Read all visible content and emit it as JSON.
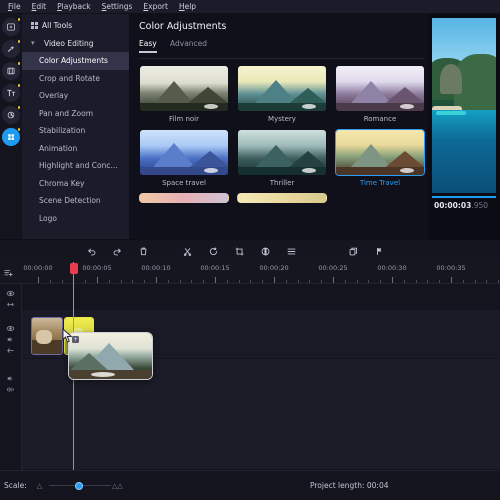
{
  "menu": {
    "items": [
      "File",
      "Edit",
      "Playback",
      "Settings",
      "Export",
      "Help"
    ]
  },
  "rail": {
    "items": [
      {
        "name": "import-media-icon",
        "glyph": "import"
      },
      {
        "name": "magic-wand-icon",
        "glyph": "wand"
      },
      {
        "name": "transitions-icon",
        "glyph": "transition"
      },
      {
        "name": "titles-icon",
        "glyph": "Tt"
      },
      {
        "name": "stickers-icon",
        "glyph": "sticker"
      },
      {
        "name": "more-tools-icon",
        "glyph": "grid"
      }
    ]
  },
  "tools_nav": {
    "all_tools": "All Tools",
    "group": "Video Editing",
    "items": [
      "Color Adjustments",
      "Crop and Rotate",
      "Overlay",
      "Pan and Zoom",
      "Stabilization",
      "Animation",
      "Highlight and Conc...",
      "Chroma Key",
      "Scene Detection",
      "Logo"
    ],
    "selected": "Color Adjustments"
  },
  "panel": {
    "title": "Color Adjustments",
    "tabs": [
      {
        "label": "Easy",
        "active": true
      },
      {
        "label": "Advanced",
        "active": false
      }
    ],
    "presets": [
      {
        "label": "Film noir",
        "selected": false
      },
      {
        "label": "Mystery",
        "selected": false
      },
      {
        "label": "Romance",
        "selected": false
      },
      {
        "label": "Space travel",
        "selected": false
      },
      {
        "label": "Thriller",
        "selected": false
      },
      {
        "label": "Time Travel",
        "selected": true
      }
    ]
  },
  "preview": {
    "timecode_main": "00:00:03",
    "timecode_ms": ".950"
  },
  "toolbar": {
    "buttons": [
      {
        "name": "undo-button",
        "icon": "undo-icon"
      },
      {
        "name": "redo-button",
        "icon": "redo-icon"
      },
      {
        "name": "delete-button",
        "icon": "trash-icon"
      },
      {
        "name": "cut-button",
        "icon": "scissors-icon"
      },
      {
        "name": "rotate-button",
        "icon": "rotate-icon"
      },
      {
        "name": "crop-button",
        "icon": "crop-icon"
      },
      {
        "name": "color-button",
        "icon": "color-adjust-icon"
      },
      {
        "name": "properties-button",
        "icon": "sliders-icon"
      },
      {
        "name": "duplicate-button",
        "icon": "duplicate-icon"
      },
      {
        "name": "marker-button",
        "icon": "flag-icon"
      }
    ]
  },
  "timeline": {
    "tick_labels": [
      "00:00:00",
      "00:00:05",
      "00:00:10",
      "00:00:15",
      "00:00:20",
      "00:00:25",
      "00:00:30",
      "00:00:35"
    ],
    "playhead_time": "00:00:03.950",
    "track_icons": [
      "eye-icon",
      "link-icon",
      "eye-icon",
      "speaker-icon",
      "arrow-left-icon",
      "speaker-icon",
      "audio-wave-icon"
    ],
    "clips": [
      {
        "name": "video-clip-1",
        "selected": false
      },
      {
        "name": "video-clip-2",
        "selected": true
      }
    ],
    "drag_badge": "+"
  },
  "status": {
    "scale_label": "Scale:",
    "project_length_label": "Project length:",
    "project_length_value": "00:04"
  },
  "colors": {
    "accent": "#2a9df4",
    "playhead": "#e83b4e",
    "selection": "#e7e54a"
  }
}
